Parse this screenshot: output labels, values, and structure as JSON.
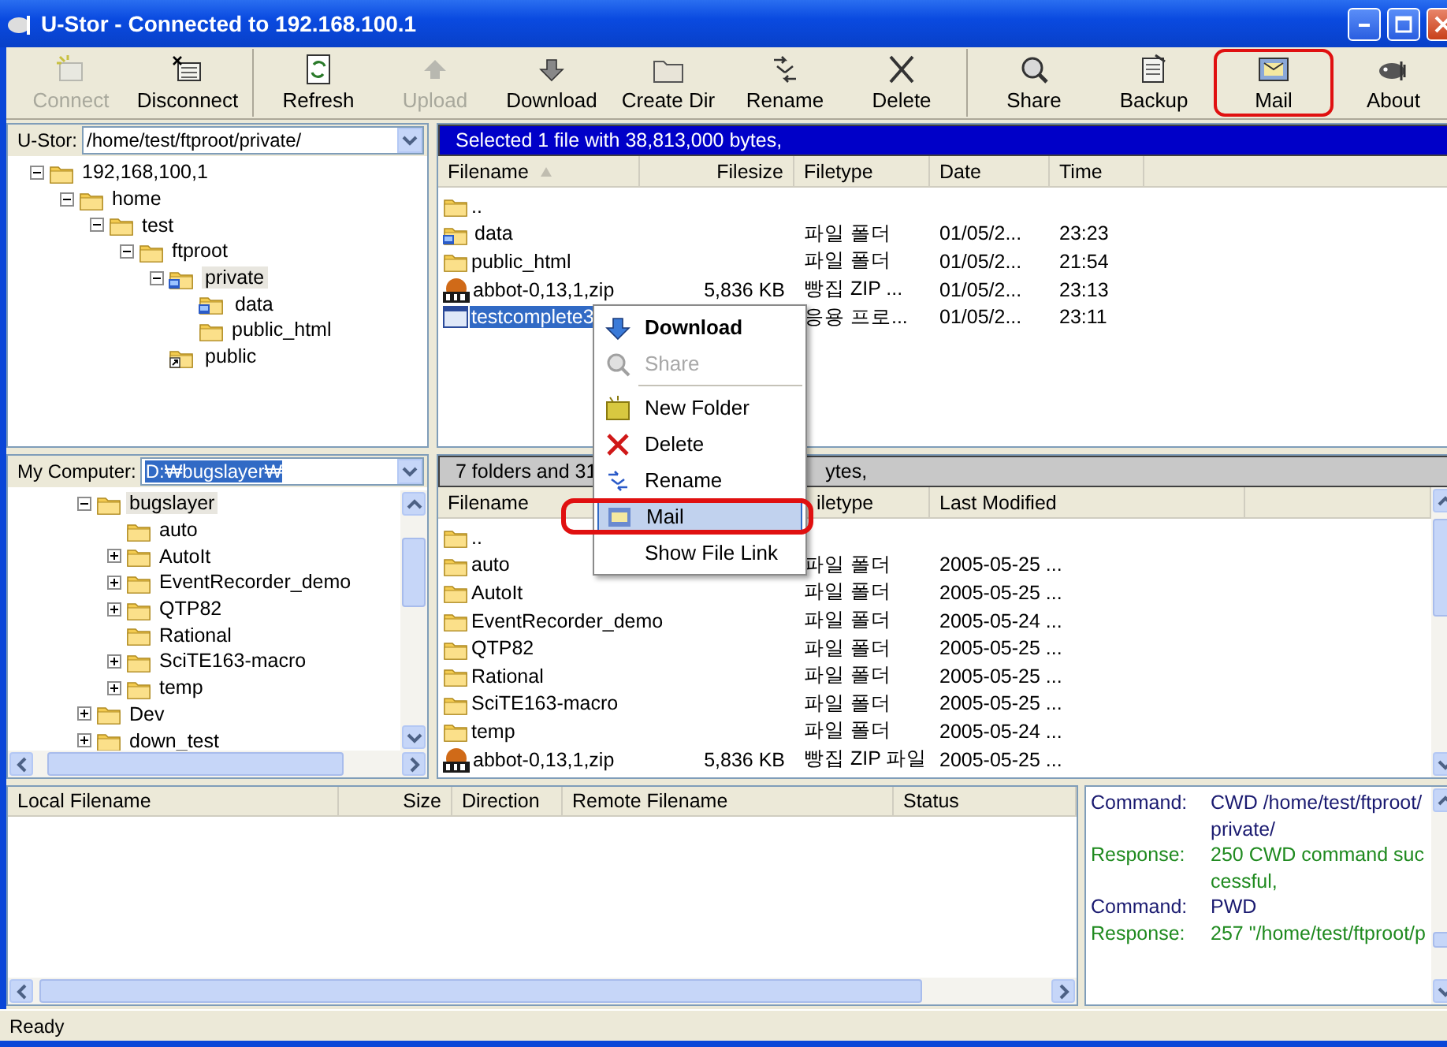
{
  "window": {
    "title": "U-Stor - Connected to 192.168.100.1"
  },
  "toolbar": [
    [
      {
        "label": "Connect",
        "disabled": true,
        "marked": false
      },
      {
        "label": "Disconnect",
        "disabled": false,
        "marked": false
      }
    ],
    [
      {
        "label": "Refresh",
        "disabled": false,
        "marked": false
      },
      {
        "label": "Upload",
        "disabled": true,
        "marked": false
      },
      {
        "label": "Download",
        "disabled": false,
        "marked": false
      },
      {
        "label": "Create Dir",
        "disabled": false,
        "marked": false
      },
      {
        "label": "Rename",
        "disabled": false,
        "marked": false
      },
      {
        "label": "Delete",
        "disabled": false,
        "marked": false
      }
    ],
    [
      {
        "label": "Share",
        "disabled": false,
        "marked": false
      },
      {
        "label": "Backup",
        "disabled": false,
        "marked": false
      },
      {
        "label": "Mail",
        "disabled": false,
        "marked": true
      },
      {
        "label": "About",
        "disabled": false,
        "marked": false
      }
    ]
  ],
  "remote": {
    "label": "U-Stor:",
    "path": "/home/test/ftproot/private/",
    "path_selected": false,
    "tree": [
      {
        "label": "192,168,100,1",
        "kind": "folder",
        "expanded": true,
        "selected": false,
        "children": [
          {
            "label": "home",
            "kind": "folder",
            "expanded": true,
            "selected": false,
            "children": [
              {
                "label": "test",
                "kind": "folder",
                "expanded": true,
                "selected": false,
                "children": [
                  {
                    "label": "ftproot",
                    "kind": "folder",
                    "expanded": true,
                    "selected": false,
                    "children": [
                      {
                        "label": "private",
                        "kind": "shared",
                        "expanded": true,
                        "selected": true,
                        "children": [
                          {
                            "label": "data",
                            "kind": "shared",
                            "selected": false
                          },
                          {
                            "label": "public_html",
                            "kind": "folder",
                            "selected": false
                          }
                        ]
                      },
                      {
                        "label": "public",
                        "kind": "link",
                        "selected": false
                      }
                    ]
                  }
                ]
              }
            ]
          }
        ]
      }
    ],
    "status": {
      "active": true,
      "parts": [
        "Selected 1 file with 38,813,000 bytes,"
      ]
    },
    "columns": [
      {
        "label": "Filename",
        "sorted": true
      },
      {
        "label": "Filesize",
        "sorted": false
      },
      {
        "label": "Filetype",
        "sorted": false
      },
      {
        "label": "Date",
        "sorted": false
      },
      {
        "label": "Time",
        "sorted": false
      }
    ],
    "rows": [
      {
        "kind": "folder",
        "name": "..",
        "selected": false
      },
      {
        "kind": "shared",
        "name": "data",
        "type": "파일 폴더",
        "date": "01/05/2...",
        "time": "23:23",
        "selected": false
      },
      {
        "kind": "folder",
        "name": "public_html",
        "type": "파일 폴더",
        "date": "01/05/2...",
        "time": "21:54",
        "selected": false
      },
      {
        "kind": "zip",
        "name": "abbot-0,13,1,zip",
        "size": "5,836 KB",
        "type": "빵집 ZIP ...",
        "date": "01/05/2...",
        "time": "23:13",
        "selected": false
      },
      {
        "kind": "app",
        "name": "testcomplete3",
        "type": "응용 프로...",
        "date": "01/05/2...",
        "time": "23:11",
        "selected": true
      }
    ]
  },
  "local": {
    "label": "My Computer:",
    "path": "D:₩bugslayer₩",
    "path_selected": true,
    "tree": [
      {
        "label": "bugslayer",
        "kind": "folder",
        "expanded": true,
        "selected": true,
        "children": [
          {
            "label": "auto",
            "kind": "folder",
            "selected": false
          },
          {
            "label": "AutoIt",
            "kind": "folder",
            "expanded": false,
            "selected": false
          },
          {
            "label": "EventRecorder_demo",
            "kind": "folder",
            "expanded": false,
            "selected": false
          },
          {
            "label": "QTP82",
            "kind": "folder",
            "expanded": false,
            "selected": false
          },
          {
            "label": "Rational",
            "kind": "folder",
            "selected": false
          },
          {
            "label": "SciTE163-macro",
            "kind": "folder",
            "expanded": false,
            "selected": false
          },
          {
            "label": "temp",
            "kind": "folder",
            "expanded": false,
            "selected": false
          }
        ]
      },
      {
        "label": "Dev",
        "kind": "folder",
        "expanded": false,
        "selected": false
      },
      {
        "label": "down_test",
        "kind": "folder",
        "expanded": false,
        "selected": false
      }
    ],
    "status": {
      "active": false,
      "parts": [
        "7 folders and 31",
        "ytes,"
      ]
    },
    "columns": [
      {
        "label": "Filename",
        "sorted": false
      },
      {
        "label": "iletype",
        "sorted": false
      },
      {
        "label": "Last Modified",
        "sorted": false
      }
    ],
    "rows": [
      {
        "kind": "folder",
        "name": "..",
        "selected": false
      },
      {
        "kind": "folder",
        "name": "auto",
        "type": "파일 폴더",
        "modified": "2005-05-25 ...",
        "selected": false
      },
      {
        "kind": "folder",
        "name": "AutoIt",
        "type": "파일 폴더",
        "modified": "2005-05-25 ...",
        "selected": false
      },
      {
        "kind": "folder",
        "name": "EventRecorder_demo",
        "type": "파일 폴더",
        "modified": "2005-05-24 ...",
        "selected": false
      },
      {
        "kind": "folder",
        "name": "QTP82",
        "type": "파일 폴더",
        "modified": "2005-05-25 ...",
        "selected": false
      },
      {
        "kind": "folder",
        "name": "Rational",
        "type": "파일 폴더",
        "modified": "2005-05-25 ...",
        "selected": false
      },
      {
        "kind": "folder",
        "name": "SciTE163-macro",
        "type": "파일 폴더",
        "modified": "2005-05-25 ...",
        "selected": false
      },
      {
        "kind": "folder",
        "name": "temp",
        "type": "파일 폴더",
        "modified": "2005-05-24 ...",
        "selected": false
      },
      {
        "kind": "zip",
        "name": "abbot-0,13,1,zip",
        "size": "5,836 KB",
        "type": "빵집 ZIP 파일",
        "modified": "2005-05-25 ...",
        "selected": false
      }
    ]
  },
  "context_menu": [
    {
      "kind": "item",
      "label": "Download",
      "bold": true,
      "disabled": false,
      "selected": false,
      "marked": false
    },
    {
      "kind": "item",
      "label": "Share",
      "bold": false,
      "disabled": true,
      "selected": false,
      "marked": false
    },
    {
      "kind": "separator"
    },
    {
      "kind": "item",
      "label": "New Folder",
      "bold": false,
      "disabled": false,
      "selected": false,
      "marked": false
    },
    {
      "kind": "item",
      "label": "Delete",
      "bold": false,
      "disabled": false,
      "selected": false,
      "marked": false
    },
    {
      "kind": "item",
      "label": "Rename",
      "bold": false,
      "disabled": false,
      "selected": false,
      "marked": false
    },
    {
      "kind": "item",
      "label": "Mail",
      "bold": false,
      "disabled": false,
      "selected": true,
      "marked": true
    },
    {
      "kind": "item",
      "label": "Show File Link",
      "bold": false,
      "disabled": false,
      "selected": false,
      "marked": false
    }
  ],
  "transfers": {
    "columns": [
      "Local Filename",
      "Size",
      "Direction",
      "Remote Filename",
      "Status"
    ]
  },
  "log": [
    {
      "kind": "command",
      "label": "Command:",
      "text": "CWD /home/test/ftproot/private/"
    },
    {
      "kind": "response",
      "label": "Response:",
      "text": "250 CWD command successful,"
    },
    {
      "kind": "command",
      "label": "Command:",
      "text": "PWD"
    },
    {
      "kind": "response",
      "label": "Response:",
      "text": "257 \"/home/test/ftproot/p"
    }
  ],
  "status_bar": "Ready"
}
